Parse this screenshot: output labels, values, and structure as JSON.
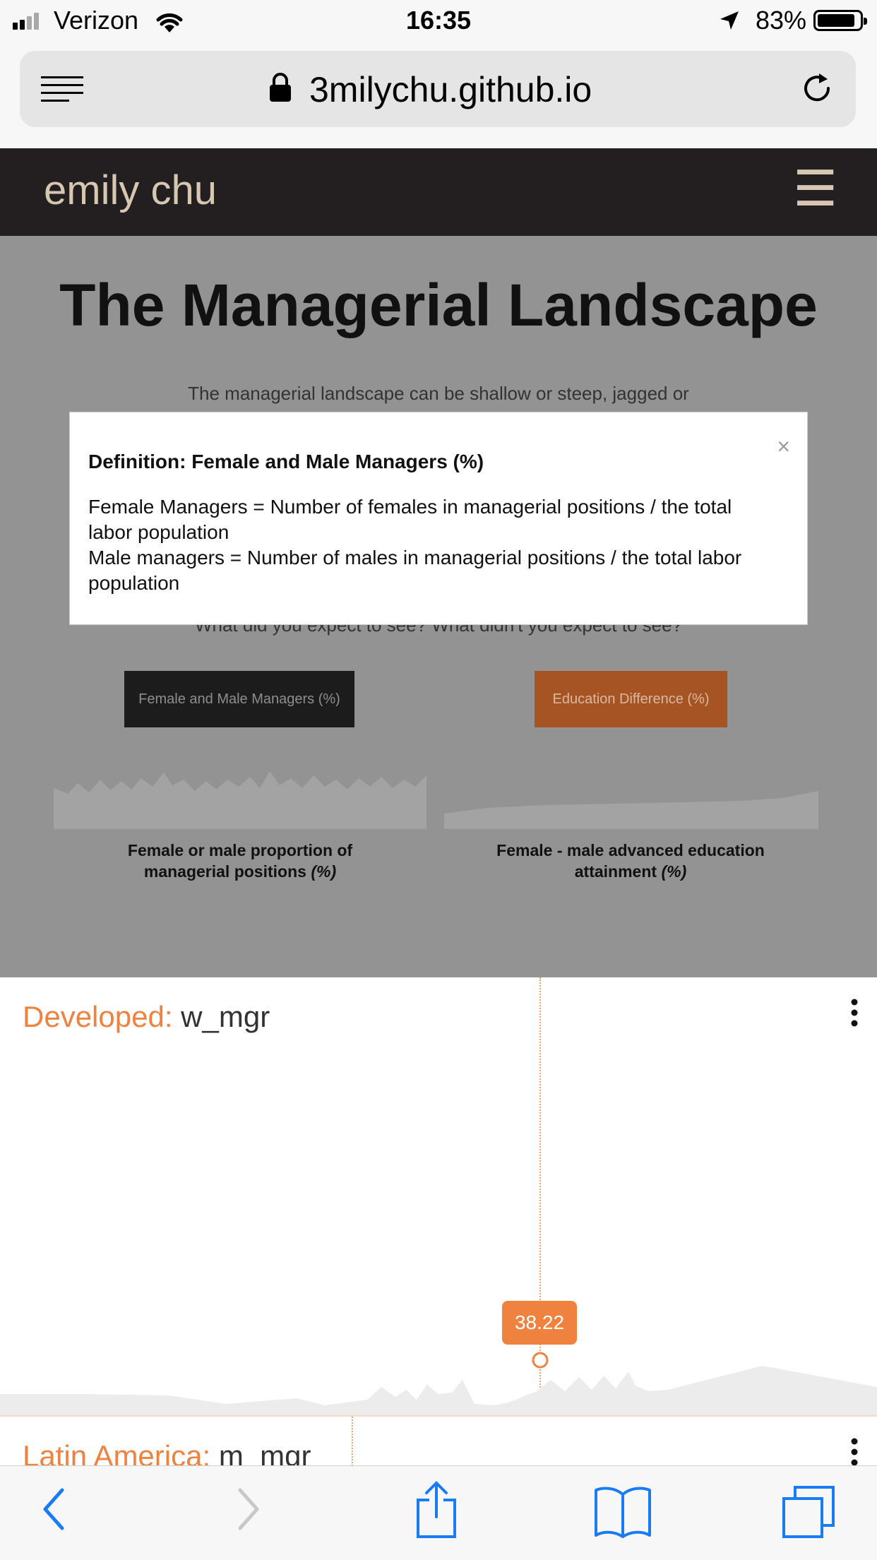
{
  "status_bar": {
    "carrier": "Verizon",
    "time": "16:35",
    "battery": "83%",
    "battery_level": 0.83
  },
  "browser": {
    "url": "3milychu.github.io"
  },
  "site": {
    "brand": "emily chu",
    "menu_icon": "☰"
  },
  "article": {
    "title": "The Managerial Landscape",
    "intro": "The managerial landscape can be shallow or steep, jagged or",
    "question": "What did you expect to see? What didn't you expect to see?",
    "buttons": [
      {
        "label": "Female and Male Managers (%)"
      },
      {
        "label": "Education Difference (%)"
      }
    ],
    "captions": [
      {
        "text": "Female or male proportion of managerial positions",
        "unit": "(%)"
      },
      {
        "text": "Female - male advanced education attainment",
        "unit": "(%)"
      }
    ]
  },
  "modal": {
    "close": "×",
    "title": "Definition: Female and Male Managers (%)",
    "line1": "Female Managers = Number of females in managerial positions / the total labor population",
    "line2": "Male managers = Number of males in managerial positions / the total labor population"
  },
  "panels": [
    {
      "region": "Developed:",
      "variable": "w_mgr",
      "tooltip": "38.22"
    },
    {
      "region": "Latin America:",
      "variable": "m_mgr"
    }
  ],
  "colors": {
    "accent": "#f08240",
    "nav_bg": "#231f20",
    "brand": "#d6c7b0",
    "ios_blue": "#1a7cf5"
  }
}
